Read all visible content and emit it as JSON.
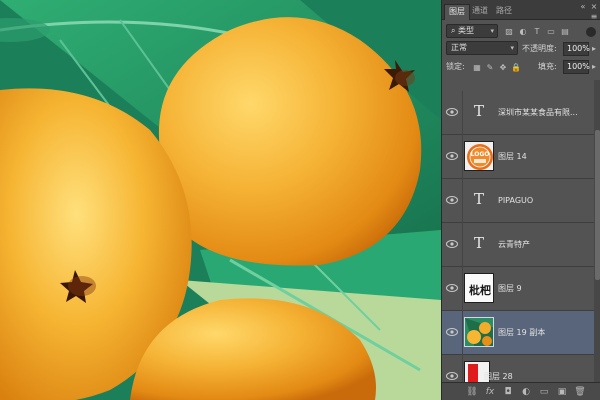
{
  "tabs": [
    {
      "label": "图层",
      "active": true
    },
    {
      "label": "通道",
      "active": false
    },
    {
      "label": "路径",
      "active": false
    }
  ],
  "panel_controls": {
    "collapse": "«",
    "close": "×",
    "menu": "≡"
  },
  "filter": {
    "kind_label": "类型",
    "icons": [
      "image-filter-icon",
      "adjustment-filter-icon",
      "type-filter-icon",
      "shape-filter-icon",
      "smartobject-filter-icon"
    ]
  },
  "blend": {
    "mode": "正常",
    "opacity_label": "不透明度:",
    "opacity_value": "100%"
  },
  "lock": {
    "label": "锁定:",
    "fill_label": "填充:",
    "fill_value": "100%"
  },
  "layers": [
    {
      "type": "text",
      "name": "深圳市某某食品有限...",
      "selected": false
    },
    {
      "type": "image",
      "name": "图层 14",
      "thumb": "LOGO",
      "selected": false
    },
    {
      "type": "text",
      "name": "PIPAGUO",
      "selected": false
    },
    {
      "type": "text",
      "name": "云青特产",
      "selected": false
    },
    {
      "type": "image",
      "name": "图层 9",
      "thumb": "枇杷",
      "selected": false
    },
    {
      "type": "image",
      "name": "图层 19 副本",
      "thumb": "art",
      "selected": true
    },
    {
      "type": "image",
      "name": "图层 28",
      "thumb": "red",
      "selected": false
    }
  ],
  "footer_icons": [
    "link-icon",
    "fx-icon",
    "mask-icon",
    "adjustment-icon",
    "group-icon",
    "new-layer-icon",
    "trash-icon"
  ],
  "footer_glyphs": [
    "⛓",
    "fx",
    "◘",
    "◐",
    "▭",
    "▣",
    "🗑"
  ],
  "colors": {
    "panel": "#535353",
    "selected": "#58657a",
    "canvas_green": "#1f8a63",
    "fruit": "#f3ab2a"
  }
}
